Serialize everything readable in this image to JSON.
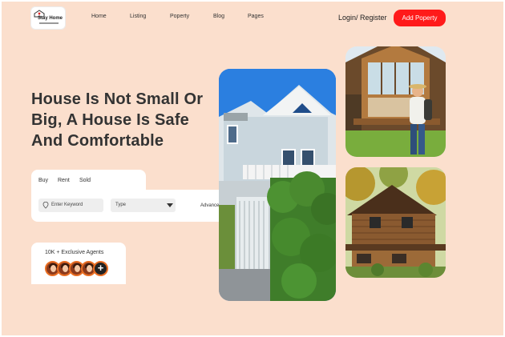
{
  "brand": {
    "logo_text": "Stay Home"
  },
  "nav": {
    "items": [
      {
        "label": "Home"
      },
      {
        "label": "Listing"
      },
      {
        "label": "Poperty"
      },
      {
        "label": "Blog"
      },
      {
        "label": "Pages"
      }
    ],
    "login_label": "Login/ Register",
    "add_property_label": "Add Poperty"
  },
  "hero": {
    "title_lines": [
      "House Is Not Small Or",
      "Big, A House Is Safe",
      "And Comfortable"
    ]
  },
  "search": {
    "tabs": [
      {
        "label": "Buy"
      },
      {
        "label": "Rent"
      },
      {
        "label": "Sold"
      }
    ],
    "keyword_placeholder": "Enter Keyword",
    "type_label": "Type",
    "advance_label": "Advance"
  },
  "agents": {
    "label": "10K + Exclusive  Agents",
    "avatar_count": 4
  },
  "images": [
    {
      "name": "tall-house-photo",
      "subject": "white-house"
    },
    {
      "name": "glass-house-photo",
      "subject": "woman-with-backpack"
    },
    {
      "name": "log-cabin-photo",
      "subject": "log-cabin"
    }
  ],
  "colors": {
    "background": "#fbdfcd",
    "accent": "#ff1a1a",
    "text": "#333333",
    "avatar_ring": "#e86d22"
  },
  "icons": {
    "search_button": "search-icon",
    "keyword_field": "location-icon",
    "type_field": "chevron-down-icon",
    "logo": "house-heart-icon"
  }
}
